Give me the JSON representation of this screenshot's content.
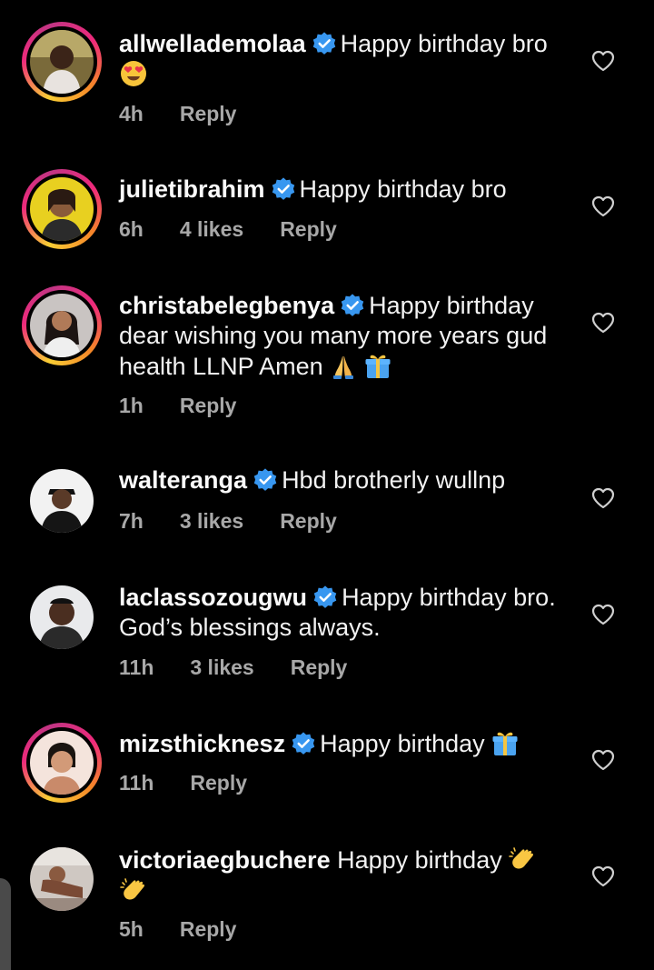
{
  "comments": [
    {
      "username": "allwellademolaa",
      "verified": true,
      "text_line1": "Happy birthday bro",
      "text_line2": "",
      "time": "4h",
      "likes": "",
      "reply": "Reply",
      "emoji1": "heart-eyes-emoji",
      "avatar_ring": "story"
    },
    {
      "username": "julietibrahim",
      "verified": true,
      "text_line1": "Happy birthday bro",
      "time": "6h",
      "likes": "4 likes",
      "reply": "Reply",
      "avatar_ring": "story"
    },
    {
      "username": "christabelegbenya",
      "verified": true,
      "text_line1": "Happy birthday",
      "text_line2": "dear wishing you many more years gud",
      "text_line3": "health LLNP Amen",
      "emoji1": "folded-hands-emoji",
      "emoji2": "gift-emoji",
      "time": "1h",
      "likes": "",
      "reply": "Reply",
      "avatar_ring": "story"
    },
    {
      "username": "walteranga",
      "verified": true,
      "text_line1": "Hbd brotherly wullnp",
      "time": "7h",
      "likes": "3 likes",
      "reply": "Reply",
      "avatar_ring": "plain"
    },
    {
      "username": "laclassozougwu",
      "verified": true,
      "text_line1": "Happy birthday bro.",
      "text_line2": "God’s blessings always.",
      "time": "11h",
      "likes": "3 likes",
      "reply": "Reply",
      "avatar_ring": "plain"
    },
    {
      "username": "mizsthicknesz",
      "verified": true,
      "text_line1": "Happy birthday",
      "emoji1": "gift-emoji",
      "time": "11h",
      "likes": "",
      "reply": "Reply",
      "avatar_ring": "story"
    },
    {
      "username": "victoriaegbuchere",
      "verified": false,
      "text_line1": "Happy birthday",
      "emoji1": "clapping-hands-emoji",
      "emoji2": "clapping-hands-emoji",
      "time": "5h",
      "likes": "",
      "reply": "Reply",
      "avatar_ring": "plain"
    }
  ],
  "colors": {
    "background": "#000000",
    "text": "#f5f5f5",
    "meta": "#a8a8a8",
    "verified": "#3897f0",
    "story_ring": [
      "#f9ce34",
      "#ee2a7b",
      "#c13584"
    ]
  },
  "icons": {
    "like": "heart-outline-icon",
    "verified": "verified-badge-icon"
  }
}
